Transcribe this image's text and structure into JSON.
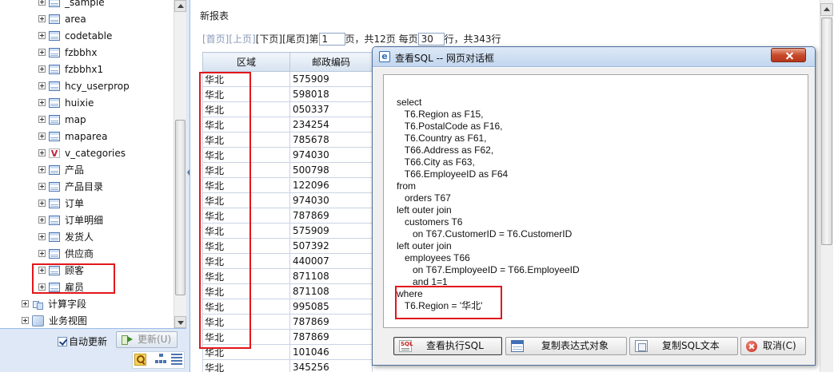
{
  "tree": {
    "items": [
      {
        "label": "_sample",
        "icon": "table-icon"
      },
      {
        "label": "area",
        "icon": "table-icon"
      },
      {
        "label": "codetable",
        "icon": "table-icon"
      },
      {
        "label": "fzbbhx",
        "icon": "table-icon"
      },
      {
        "label": "fzbbhx1",
        "icon": "table-icon"
      },
      {
        "label": "hcy_userprop",
        "icon": "table-icon"
      },
      {
        "label": "huixie",
        "icon": "table-icon"
      },
      {
        "label": "map",
        "icon": "table-icon"
      },
      {
        "label": "maparea",
        "icon": "table-icon"
      },
      {
        "label": "v_categories",
        "icon": "view-icon"
      },
      {
        "label": "产品",
        "icon": "table-icon"
      },
      {
        "label": "产品目录",
        "icon": "table-icon"
      },
      {
        "label": "订单",
        "icon": "table-icon"
      },
      {
        "label": "订单明细",
        "icon": "table-icon"
      },
      {
        "label": "发货人",
        "icon": "table-icon"
      },
      {
        "label": "供应商",
        "icon": "table-icon"
      },
      {
        "label": "顾客",
        "icon": "table-icon"
      },
      {
        "label": "雇员",
        "icon": "table-icon"
      }
    ],
    "roots": [
      {
        "label": "计算字段",
        "icon": "calc-field-icon"
      },
      {
        "label": "业务视图",
        "icon": "business-view-icon"
      }
    ],
    "view_icon_glyph": "V"
  },
  "left_toolbar": {
    "auto_update_label": "自动更新",
    "auto_update_checked": true,
    "update_button_label": "更新(U)"
  },
  "report": {
    "title": "新报表",
    "pager": {
      "first": "[首页]",
      "prev": "[上页]",
      "next": "[下页]",
      "last": "[尾页]",
      "page_prefix": "第",
      "current_page": "1",
      "page_suffix": "页，共12页",
      "per_page_prefix": "每页",
      "per_page": "30",
      "per_page_suffix": "行，共343行"
    },
    "columns": [
      "区域",
      "邮政编码"
    ],
    "rows": [
      [
        "华北",
        "575909"
      ],
      [
        "华北",
        "598018"
      ],
      [
        "华北",
        "050337"
      ],
      [
        "华北",
        "234254"
      ],
      [
        "华北",
        "785678"
      ],
      [
        "华北",
        "974030"
      ],
      [
        "华北",
        "500798"
      ],
      [
        "华北",
        "122096"
      ],
      [
        "华北",
        "974030"
      ],
      [
        "华北",
        "787869"
      ],
      [
        "华北",
        "575909"
      ],
      [
        "华北",
        "507392"
      ],
      [
        "华北",
        "440007"
      ],
      [
        "华北",
        "871108"
      ],
      [
        "华北",
        "871108"
      ],
      [
        "华北",
        "995085"
      ],
      [
        "华北",
        "787869"
      ],
      [
        "华北",
        "787869"
      ],
      [
        "华北",
        "101046"
      ],
      [
        "华北",
        "345256"
      ]
    ]
  },
  "dialog": {
    "title": "查看SQL -- 网页对话框",
    "sql": "select\n   T6.Region as F15,\n   T6.PostalCode as F16,\n   T6.Country as F61,\n   T66.Address as F62,\n   T66.City as F63,\n   T66.EmployeeID as F64\nfrom\n   orders T67\nleft outer join\n   customers T6\n      on T67.CustomerID = T6.CustomerID\nleft outer join\n   employees T66\n      on T67.EmployeeID = T66.EmployeeID\n      and 1=1\nwhere\n   T6.Region = '华北'",
    "buttons": {
      "exec_sql": "查看执行SQL",
      "copy_expr": "复制表达式对象",
      "copy_sql": "复制SQL文本",
      "cancel": "取消(C)"
    },
    "exec_icon_text": "SQL"
  },
  "colors": {
    "highlight": "#e2161b",
    "panel_border": "#99bbe8",
    "toolbar_bg": "#dfe8f6"
  }
}
